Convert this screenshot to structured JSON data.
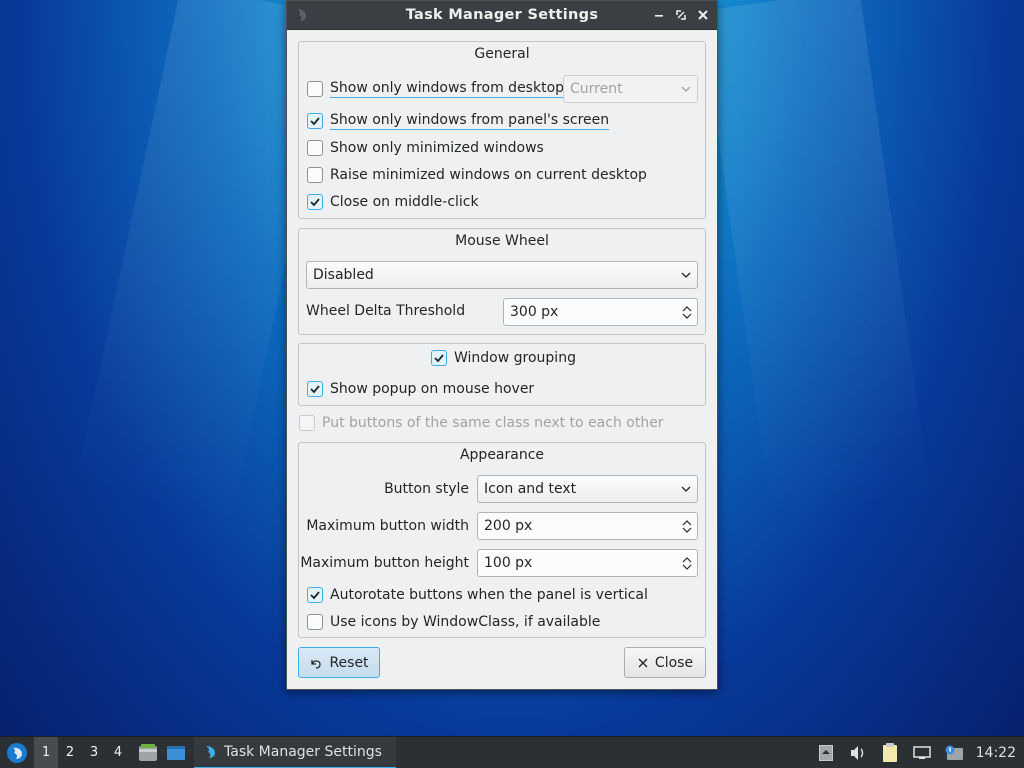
{
  "window": {
    "title": "Task Manager Settings"
  },
  "general": {
    "title": "General",
    "show_only_desktop": {
      "label": "Show only windows from desktop",
      "checked": false
    },
    "desktop_combo": "Current",
    "show_only_panel_screen": {
      "label": "Show only windows from panel's screen",
      "checked": true
    },
    "show_only_minimized": {
      "label": "Show only minimized windows",
      "checked": false
    },
    "raise_minimized": {
      "label": "Raise minimized windows on current desktop",
      "checked": false
    },
    "close_middle_click": {
      "label": "Close on middle-click",
      "checked": true
    }
  },
  "mouse_wheel": {
    "title": "Mouse Wheel",
    "mode": "Disabled",
    "threshold_label": "Wheel Delta Threshold",
    "threshold_value": "300 px"
  },
  "grouping": {
    "window_grouping": {
      "label": "Window grouping",
      "checked": true
    },
    "show_popup": {
      "label": "Show popup on mouse hover",
      "checked": true
    }
  },
  "same_class": {
    "label": "Put buttons of the same class next to each other",
    "checked": false,
    "disabled": true
  },
  "appearance": {
    "title": "Appearance",
    "button_style_label": "Button style",
    "button_style_value": "Icon and text",
    "max_width_label": "Maximum button width",
    "max_width_value": "200 px",
    "max_height_label": "Maximum button height",
    "max_height_value": "100 px",
    "autorotate": {
      "label": "Autorotate buttons when the panel is vertical",
      "checked": true
    },
    "use_icons": {
      "label": "Use icons by WindowClass, if available",
      "checked": false
    }
  },
  "buttons": {
    "reset": "Reset",
    "close": "Close"
  },
  "taskbar": {
    "desktops": [
      "1",
      "2",
      "3",
      "4"
    ],
    "active_desktop": "1",
    "task_title": "Task Manager Settings",
    "clock": "14:22"
  },
  "colors": {
    "accent": "#3daee9",
    "titlebar": "#3b3f43",
    "window_bg": "#eff0f1",
    "taskbar": "#2b3035"
  }
}
